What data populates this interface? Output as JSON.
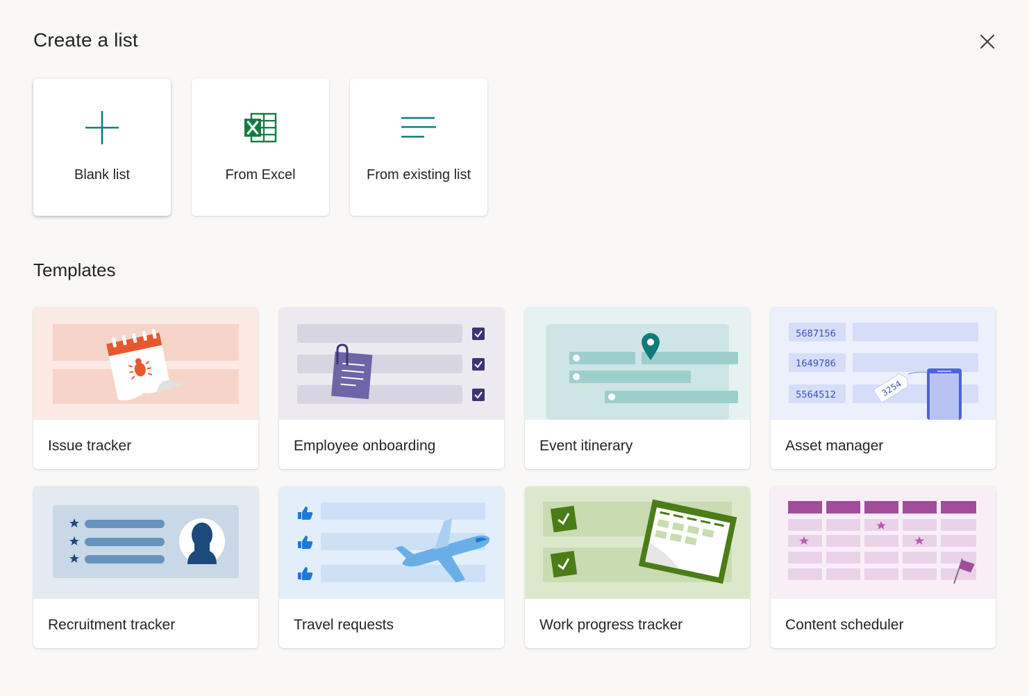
{
  "dialog": {
    "title": "Create a list",
    "close_icon": "close-icon"
  },
  "create_options": [
    {
      "label": "Blank list",
      "icon": "plus-icon"
    },
    {
      "label": "From Excel",
      "icon": "excel-icon"
    },
    {
      "label": "From existing list",
      "icon": "list-lines-icon"
    }
  ],
  "templates_section": {
    "title": "Templates",
    "items": [
      {
        "label": "Issue tracker"
      },
      {
        "label": "Employee onboarding"
      },
      {
        "label": "Event itinerary"
      },
      {
        "label": "Asset manager",
        "asset_ids": [
          "5687156",
          "1649786",
          "5564512"
        ],
        "tag": "3254"
      },
      {
        "label": "Recruitment tracker"
      },
      {
        "label": "Travel requests"
      },
      {
        "label": "Work progress tracker"
      },
      {
        "label": "Content scheduler"
      }
    ]
  },
  "colors": {
    "accent": "#0f7b7b",
    "excel_green": "#107c41",
    "background": "#f9f8f6"
  }
}
